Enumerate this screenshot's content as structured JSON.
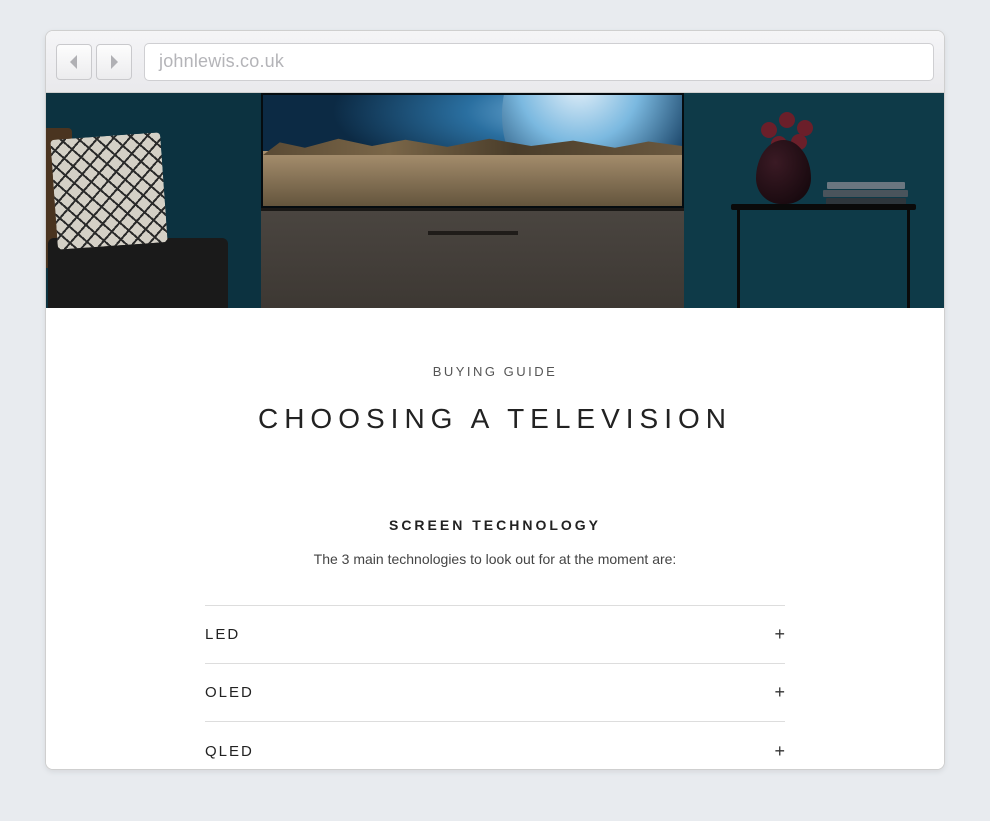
{
  "browser": {
    "url": "johnlewis.co.uk"
  },
  "page": {
    "eyebrow": "BUYING GUIDE",
    "title": "CHOOSING A TELEVISION",
    "section_heading": "SCREEN TECHNOLOGY",
    "section_sub": "The 3 main technologies to look out for at the moment are:"
  },
  "accordion": {
    "plus": "+",
    "items": [
      {
        "label": "LED"
      },
      {
        "label": "OLED"
      },
      {
        "label": "QLED"
      }
    ]
  }
}
